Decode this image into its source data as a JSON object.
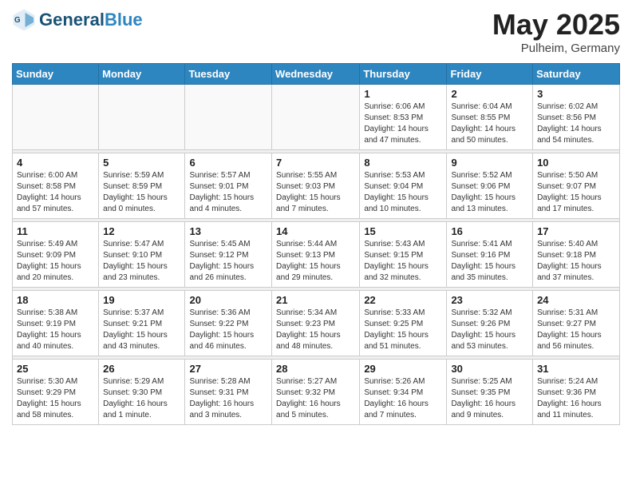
{
  "header": {
    "logo_general": "General",
    "logo_blue": "Blue",
    "month": "May 2025",
    "location": "Pulheim, Germany"
  },
  "weekdays": [
    "Sunday",
    "Monday",
    "Tuesday",
    "Wednesday",
    "Thursday",
    "Friday",
    "Saturday"
  ],
  "weeks": [
    [
      {
        "day": "",
        "sunrise": "",
        "sunset": "",
        "daylight": ""
      },
      {
        "day": "",
        "sunrise": "",
        "sunset": "",
        "daylight": ""
      },
      {
        "day": "",
        "sunrise": "",
        "sunset": "",
        "daylight": ""
      },
      {
        "day": "",
        "sunrise": "",
        "sunset": "",
        "daylight": ""
      },
      {
        "day": "1",
        "sunrise": "Sunrise: 6:06 AM",
        "sunset": "Sunset: 8:53 PM",
        "daylight": "Daylight: 14 hours and 47 minutes."
      },
      {
        "day": "2",
        "sunrise": "Sunrise: 6:04 AM",
        "sunset": "Sunset: 8:55 PM",
        "daylight": "Daylight: 14 hours and 50 minutes."
      },
      {
        "day": "3",
        "sunrise": "Sunrise: 6:02 AM",
        "sunset": "Sunset: 8:56 PM",
        "daylight": "Daylight: 14 hours and 54 minutes."
      }
    ],
    [
      {
        "day": "4",
        "sunrise": "Sunrise: 6:00 AM",
        "sunset": "Sunset: 8:58 PM",
        "daylight": "Daylight: 14 hours and 57 minutes."
      },
      {
        "day": "5",
        "sunrise": "Sunrise: 5:59 AM",
        "sunset": "Sunset: 8:59 PM",
        "daylight": "Daylight: 15 hours and 0 minutes."
      },
      {
        "day": "6",
        "sunrise": "Sunrise: 5:57 AM",
        "sunset": "Sunset: 9:01 PM",
        "daylight": "Daylight: 15 hours and 4 minutes."
      },
      {
        "day": "7",
        "sunrise": "Sunrise: 5:55 AM",
        "sunset": "Sunset: 9:03 PM",
        "daylight": "Daylight: 15 hours and 7 minutes."
      },
      {
        "day": "8",
        "sunrise": "Sunrise: 5:53 AM",
        "sunset": "Sunset: 9:04 PM",
        "daylight": "Daylight: 15 hours and 10 minutes."
      },
      {
        "day": "9",
        "sunrise": "Sunrise: 5:52 AM",
        "sunset": "Sunset: 9:06 PM",
        "daylight": "Daylight: 15 hours and 13 minutes."
      },
      {
        "day": "10",
        "sunrise": "Sunrise: 5:50 AM",
        "sunset": "Sunset: 9:07 PM",
        "daylight": "Daylight: 15 hours and 17 minutes."
      }
    ],
    [
      {
        "day": "11",
        "sunrise": "Sunrise: 5:49 AM",
        "sunset": "Sunset: 9:09 PM",
        "daylight": "Daylight: 15 hours and 20 minutes."
      },
      {
        "day": "12",
        "sunrise": "Sunrise: 5:47 AM",
        "sunset": "Sunset: 9:10 PM",
        "daylight": "Daylight: 15 hours and 23 minutes."
      },
      {
        "day": "13",
        "sunrise": "Sunrise: 5:45 AM",
        "sunset": "Sunset: 9:12 PM",
        "daylight": "Daylight: 15 hours and 26 minutes."
      },
      {
        "day": "14",
        "sunrise": "Sunrise: 5:44 AM",
        "sunset": "Sunset: 9:13 PM",
        "daylight": "Daylight: 15 hours and 29 minutes."
      },
      {
        "day": "15",
        "sunrise": "Sunrise: 5:43 AM",
        "sunset": "Sunset: 9:15 PM",
        "daylight": "Daylight: 15 hours and 32 minutes."
      },
      {
        "day": "16",
        "sunrise": "Sunrise: 5:41 AM",
        "sunset": "Sunset: 9:16 PM",
        "daylight": "Daylight: 15 hours and 35 minutes."
      },
      {
        "day": "17",
        "sunrise": "Sunrise: 5:40 AM",
        "sunset": "Sunset: 9:18 PM",
        "daylight": "Daylight: 15 hours and 37 minutes."
      }
    ],
    [
      {
        "day": "18",
        "sunrise": "Sunrise: 5:38 AM",
        "sunset": "Sunset: 9:19 PM",
        "daylight": "Daylight: 15 hours and 40 minutes."
      },
      {
        "day": "19",
        "sunrise": "Sunrise: 5:37 AM",
        "sunset": "Sunset: 9:21 PM",
        "daylight": "Daylight: 15 hours and 43 minutes."
      },
      {
        "day": "20",
        "sunrise": "Sunrise: 5:36 AM",
        "sunset": "Sunset: 9:22 PM",
        "daylight": "Daylight: 15 hours and 46 minutes."
      },
      {
        "day": "21",
        "sunrise": "Sunrise: 5:34 AM",
        "sunset": "Sunset: 9:23 PM",
        "daylight": "Daylight: 15 hours and 48 minutes."
      },
      {
        "day": "22",
        "sunrise": "Sunrise: 5:33 AM",
        "sunset": "Sunset: 9:25 PM",
        "daylight": "Daylight: 15 hours and 51 minutes."
      },
      {
        "day": "23",
        "sunrise": "Sunrise: 5:32 AM",
        "sunset": "Sunset: 9:26 PM",
        "daylight": "Daylight: 15 hours and 53 minutes."
      },
      {
        "day": "24",
        "sunrise": "Sunrise: 5:31 AM",
        "sunset": "Sunset: 9:27 PM",
        "daylight": "Daylight: 15 hours and 56 minutes."
      }
    ],
    [
      {
        "day": "25",
        "sunrise": "Sunrise: 5:30 AM",
        "sunset": "Sunset: 9:29 PM",
        "daylight": "Daylight: 15 hours and 58 minutes."
      },
      {
        "day": "26",
        "sunrise": "Sunrise: 5:29 AM",
        "sunset": "Sunset: 9:30 PM",
        "daylight": "Daylight: 16 hours and 1 minute."
      },
      {
        "day": "27",
        "sunrise": "Sunrise: 5:28 AM",
        "sunset": "Sunset: 9:31 PM",
        "daylight": "Daylight: 16 hours and 3 minutes."
      },
      {
        "day": "28",
        "sunrise": "Sunrise: 5:27 AM",
        "sunset": "Sunset: 9:32 PM",
        "daylight": "Daylight: 16 hours and 5 minutes."
      },
      {
        "day": "29",
        "sunrise": "Sunrise: 5:26 AM",
        "sunset": "Sunset: 9:34 PM",
        "daylight": "Daylight: 16 hours and 7 minutes."
      },
      {
        "day": "30",
        "sunrise": "Sunrise: 5:25 AM",
        "sunset": "Sunset: 9:35 PM",
        "daylight": "Daylight: 16 hours and 9 minutes."
      },
      {
        "day": "31",
        "sunrise": "Sunrise: 5:24 AM",
        "sunset": "Sunset: 9:36 PM",
        "daylight": "Daylight: 16 hours and 11 minutes."
      }
    ]
  ]
}
